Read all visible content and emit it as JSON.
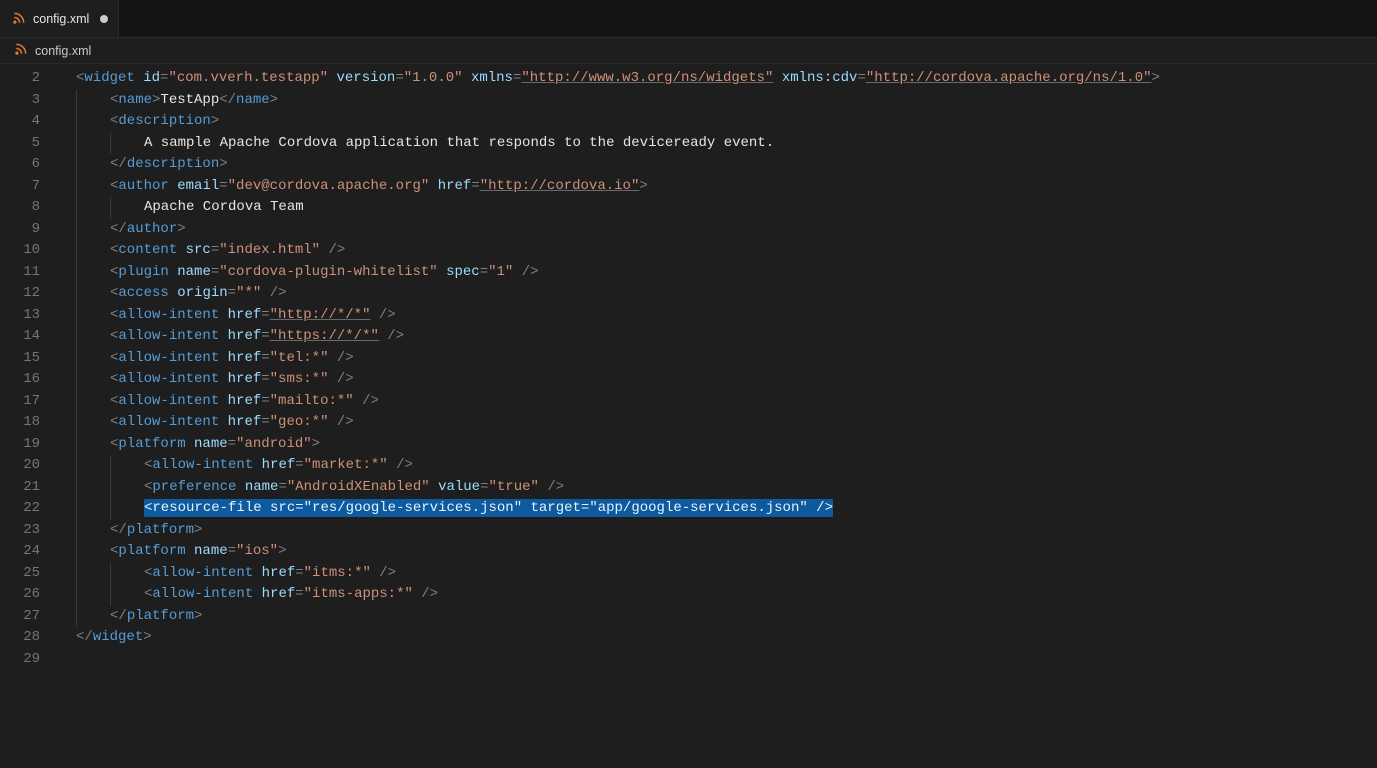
{
  "tab": {
    "filename": "config.xml",
    "dirty": true
  },
  "breadcrumb": {
    "filename": "config.xml"
  },
  "gutter": {
    "start": 2,
    "end": 29
  },
  "code": {
    "lines": [
      {
        "n": 2,
        "indent": 0,
        "sel": false,
        "tokens": [
          {
            "t": "punc",
            "s": "<"
          },
          {
            "t": "tag",
            "s": "widget"
          },
          {
            "t": "text",
            "s": " "
          },
          {
            "t": "attr",
            "s": "id"
          },
          {
            "t": "punc",
            "s": "="
          },
          {
            "t": "str",
            "s": "\"com.vverh.testapp\""
          },
          {
            "t": "text",
            "s": " "
          },
          {
            "t": "attr",
            "s": "version"
          },
          {
            "t": "punc",
            "s": "="
          },
          {
            "t": "str",
            "s": "\"1.0.0\""
          },
          {
            "t": "text",
            "s": " "
          },
          {
            "t": "attr",
            "s": "xmlns"
          },
          {
            "t": "punc",
            "s": "="
          },
          {
            "t": "strl",
            "s": "\"http://www.w3.org/ns/widgets\""
          },
          {
            "t": "text",
            "s": " "
          },
          {
            "t": "attr",
            "s": "xmlns:cdv"
          },
          {
            "t": "punc",
            "s": "="
          },
          {
            "t": "strl",
            "s": "\"http://cordova.apache.org/ns/1.0\""
          },
          {
            "t": "punc",
            "s": ">"
          }
        ]
      },
      {
        "n": 3,
        "indent": 1,
        "sel": false,
        "tokens": [
          {
            "t": "punc",
            "s": "<"
          },
          {
            "t": "tag",
            "s": "name"
          },
          {
            "t": "punc",
            "s": ">"
          },
          {
            "t": "text",
            "s": "TestApp"
          },
          {
            "t": "punc",
            "s": "</"
          },
          {
            "t": "tag",
            "s": "name"
          },
          {
            "t": "punc",
            "s": ">"
          }
        ]
      },
      {
        "n": 4,
        "indent": 1,
        "sel": false,
        "tokens": [
          {
            "t": "punc",
            "s": "<"
          },
          {
            "t": "tag",
            "s": "description"
          },
          {
            "t": "punc",
            "s": ">"
          }
        ]
      },
      {
        "n": 5,
        "indent": 2,
        "sel": false,
        "tokens": [
          {
            "t": "text",
            "s": "A sample Apache Cordova application that responds to the deviceready event."
          }
        ]
      },
      {
        "n": 6,
        "indent": 1,
        "sel": false,
        "tokens": [
          {
            "t": "punc",
            "s": "</"
          },
          {
            "t": "tag",
            "s": "description"
          },
          {
            "t": "punc",
            "s": ">"
          }
        ]
      },
      {
        "n": 7,
        "indent": 1,
        "sel": false,
        "tokens": [
          {
            "t": "punc",
            "s": "<"
          },
          {
            "t": "tag",
            "s": "author"
          },
          {
            "t": "text",
            "s": " "
          },
          {
            "t": "attr",
            "s": "email"
          },
          {
            "t": "punc",
            "s": "="
          },
          {
            "t": "str",
            "s": "\"dev@cordova.apache.org\""
          },
          {
            "t": "text",
            "s": " "
          },
          {
            "t": "attr",
            "s": "href"
          },
          {
            "t": "punc",
            "s": "="
          },
          {
            "t": "strl",
            "s": "\"http://cordova.io\""
          },
          {
            "t": "punc",
            "s": ">"
          }
        ]
      },
      {
        "n": 8,
        "indent": 2,
        "sel": false,
        "tokens": [
          {
            "t": "text",
            "s": "Apache Cordova Team"
          }
        ]
      },
      {
        "n": 9,
        "indent": 1,
        "sel": false,
        "tokens": [
          {
            "t": "punc",
            "s": "</"
          },
          {
            "t": "tag",
            "s": "author"
          },
          {
            "t": "punc",
            "s": ">"
          }
        ]
      },
      {
        "n": 10,
        "indent": 1,
        "sel": false,
        "tokens": [
          {
            "t": "punc",
            "s": "<"
          },
          {
            "t": "tag",
            "s": "content"
          },
          {
            "t": "text",
            "s": " "
          },
          {
            "t": "attr",
            "s": "src"
          },
          {
            "t": "punc",
            "s": "="
          },
          {
            "t": "str",
            "s": "\"index.html\""
          },
          {
            "t": "text",
            "s": " "
          },
          {
            "t": "punc",
            "s": "/>"
          }
        ]
      },
      {
        "n": 11,
        "indent": 1,
        "sel": false,
        "tokens": [
          {
            "t": "punc",
            "s": "<"
          },
          {
            "t": "tag",
            "s": "plugin"
          },
          {
            "t": "text",
            "s": " "
          },
          {
            "t": "attr",
            "s": "name"
          },
          {
            "t": "punc",
            "s": "="
          },
          {
            "t": "str",
            "s": "\"cordova-plugin-whitelist\""
          },
          {
            "t": "text",
            "s": " "
          },
          {
            "t": "attr",
            "s": "spec"
          },
          {
            "t": "punc",
            "s": "="
          },
          {
            "t": "str",
            "s": "\"1\""
          },
          {
            "t": "text",
            "s": " "
          },
          {
            "t": "punc",
            "s": "/>"
          }
        ]
      },
      {
        "n": 12,
        "indent": 1,
        "sel": false,
        "tokens": [
          {
            "t": "punc",
            "s": "<"
          },
          {
            "t": "tag",
            "s": "access"
          },
          {
            "t": "text",
            "s": " "
          },
          {
            "t": "attr",
            "s": "origin"
          },
          {
            "t": "punc",
            "s": "="
          },
          {
            "t": "str",
            "s": "\"*\""
          },
          {
            "t": "text",
            "s": " "
          },
          {
            "t": "punc",
            "s": "/>"
          }
        ]
      },
      {
        "n": 13,
        "indent": 1,
        "sel": false,
        "tokens": [
          {
            "t": "punc",
            "s": "<"
          },
          {
            "t": "tag",
            "s": "allow-intent"
          },
          {
            "t": "text",
            "s": " "
          },
          {
            "t": "attr",
            "s": "href"
          },
          {
            "t": "punc",
            "s": "="
          },
          {
            "t": "strl",
            "s": "\"http://*/*\""
          },
          {
            "t": "text",
            "s": " "
          },
          {
            "t": "punc",
            "s": "/>"
          }
        ]
      },
      {
        "n": 14,
        "indent": 1,
        "sel": false,
        "tokens": [
          {
            "t": "punc",
            "s": "<"
          },
          {
            "t": "tag",
            "s": "allow-intent"
          },
          {
            "t": "text",
            "s": " "
          },
          {
            "t": "attr",
            "s": "href"
          },
          {
            "t": "punc",
            "s": "="
          },
          {
            "t": "strl",
            "s": "\"https://*/*\""
          },
          {
            "t": "text",
            "s": " "
          },
          {
            "t": "punc",
            "s": "/>"
          }
        ]
      },
      {
        "n": 15,
        "indent": 1,
        "sel": false,
        "tokens": [
          {
            "t": "punc",
            "s": "<"
          },
          {
            "t": "tag",
            "s": "allow-intent"
          },
          {
            "t": "text",
            "s": " "
          },
          {
            "t": "attr",
            "s": "href"
          },
          {
            "t": "punc",
            "s": "="
          },
          {
            "t": "str",
            "s": "\"tel:*\""
          },
          {
            "t": "text",
            "s": " "
          },
          {
            "t": "punc",
            "s": "/>"
          }
        ]
      },
      {
        "n": 16,
        "indent": 1,
        "sel": false,
        "tokens": [
          {
            "t": "punc",
            "s": "<"
          },
          {
            "t": "tag",
            "s": "allow-intent"
          },
          {
            "t": "text",
            "s": " "
          },
          {
            "t": "attr",
            "s": "href"
          },
          {
            "t": "punc",
            "s": "="
          },
          {
            "t": "str",
            "s": "\"sms:*\""
          },
          {
            "t": "text",
            "s": " "
          },
          {
            "t": "punc",
            "s": "/>"
          }
        ]
      },
      {
        "n": 17,
        "indent": 1,
        "sel": false,
        "tokens": [
          {
            "t": "punc",
            "s": "<"
          },
          {
            "t": "tag",
            "s": "allow-intent"
          },
          {
            "t": "text",
            "s": " "
          },
          {
            "t": "attr",
            "s": "href"
          },
          {
            "t": "punc",
            "s": "="
          },
          {
            "t": "str",
            "s": "\"mailto:*\""
          },
          {
            "t": "text",
            "s": " "
          },
          {
            "t": "punc",
            "s": "/>"
          }
        ]
      },
      {
        "n": 18,
        "indent": 1,
        "sel": false,
        "tokens": [
          {
            "t": "punc",
            "s": "<"
          },
          {
            "t": "tag",
            "s": "allow-intent"
          },
          {
            "t": "text",
            "s": " "
          },
          {
            "t": "attr",
            "s": "href"
          },
          {
            "t": "punc",
            "s": "="
          },
          {
            "t": "str",
            "s": "\"geo:*\""
          },
          {
            "t": "text",
            "s": " "
          },
          {
            "t": "punc",
            "s": "/>"
          }
        ]
      },
      {
        "n": 19,
        "indent": 1,
        "sel": false,
        "tokens": [
          {
            "t": "punc",
            "s": "<"
          },
          {
            "t": "tag",
            "s": "platform"
          },
          {
            "t": "text",
            "s": " "
          },
          {
            "t": "attr",
            "s": "name"
          },
          {
            "t": "punc",
            "s": "="
          },
          {
            "t": "str",
            "s": "\"android\""
          },
          {
            "t": "punc",
            "s": ">"
          }
        ]
      },
      {
        "n": 20,
        "indent": 2,
        "sel": false,
        "tokens": [
          {
            "t": "punc",
            "s": "<"
          },
          {
            "t": "tag",
            "s": "allow-intent"
          },
          {
            "t": "text",
            "s": " "
          },
          {
            "t": "attr",
            "s": "href"
          },
          {
            "t": "punc",
            "s": "="
          },
          {
            "t": "str",
            "s": "\"market:*\""
          },
          {
            "t": "text",
            "s": " "
          },
          {
            "t": "punc",
            "s": "/>"
          }
        ]
      },
      {
        "n": 21,
        "indent": 2,
        "sel": false,
        "tokens": [
          {
            "t": "punc",
            "s": "<"
          },
          {
            "t": "tag",
            "s": "preference"
          },
          {
            "t": "text",
            "s": " "
          },
          {
            "t": "attr",
            "s": "name"
          },
          {
            "t": "punc",
            "s": "="
          },
          {
            "t": "str",
            "s": "\"AndroidXEnabled\""
          },
          {
            "t": "text",
            "s": " "
          },
          {
            "t": "attr",
            "s": "value"
          },
          {
            "t": "punc",
            "s": "="
          },
          {
            "t": "str",
            "s": "\"true\""
          },
          {
            "t": "text",
            "s": " "
          },
          {
            "t": "punc",
            "s": "/>"
          }
        ]
      },
      {
        "n": 22,
        "indent": 2,
        "sel": true,
        "tokens": [
          {
            "t": "punc",
            "s": "<"
          },
          {
            "t": "tag",
            "s": "resource-file"
          },
          {
            "t": "text",
            "s": " "
          },
          {
            "t": "attr",
            "s": "src"
          },
          {
            "t": "punc",
            "s": "="
          },
          {
            "t": "str",
            "s": "\"res/google-services.json\""
          },
          {
            "t": "text",
            "s": " "
          },
          {
            "t": "attr",
            "s": "target"
          },
          {
            "t": "punc",
            "s": "="
          },
          {
            "t": "str",
            "s": "\"app/google-services.json\""
          },
          {
            "t": "text",
            "s": " "
          },
          {
            "t": "punc",
            "s": "/>"
          }
        ]
      },
      {
        "n": 23,
        "indent": 1,
        "sel": false,
        "tokens": [
          {
            "t": "punc",
            "s": "</"
          },
          {
            "t": "tag",
            "s": "platform"
          },
          {
            "t": "punc",
            "s": ">"
          }
        ]
      },
      {
        "n": 24,
        "indent": 1,
        "sel": false,
        "tokens": [
          {
            "t": "punc",
            "s": "<"
          },
          {
            "t": "tag",
            "s": "platform"
          },
          {
            "t": "text",
            "s": " "
          },
          {
            "t": "attr",
            "s": "name"
          },
          {
            "t": "punc",
            "s": "="
          },
          {
            "t": "str",
            "s": "\"ios\""
          },
          {
            "t": "punc",
            "s": ">"
          }
        ]
      },
      {
        "n": 25,
        "indent": 2,
        "sel": false,
        "tokens": [
          {
            "t": "punc",
            "s": "<"
          },
          {
            "t": "tag",
            "s": "allow-intent"
          },
          {
            "t": "text",
            "s": " "
          },
          {
            "t": "attr",
            "s": "href"
          },
          {
            "t": "punc",
            "s": "="
          },
          {
            "t": "str",
            "s": "\"itms:*\""
          },
          {
            "t": "text",
            "s": " "
          },
          {
            "t": "punc",
            "s": "/>"
          }
        ]
      },
      {
        "n": 26,
        "indent": 2,
        "sel": false,
        "tokens": [
          {
            "t": "punc",
            "s": "<"
          },
          {
            "t": "tag",
            "s": "allow-intent"
          },
          {
            "t": "text",
            "s": " "
          },
          {
            "t": "attr",
            "s": "href"
          },
          {
            "t": "punc",
            "s": "="
          },
          {
            "t": "str",
            "s": "\"itms-apps:*\""
          },
          {
            "t": "text",
            "s": " "
          },
          {
            "t": "punc",
            "s": "/>"
          }
        ]
      },
      {
        "n": 27,
        "indent": 1,
        "sel": false,
        "tokens": [
          {
            "t": "punc",
            "s": "</"
          },
          {
            "t": "tag",
            "s": "platform"
          },
          {
            "t": "punc",
            "s": ">"
          }
        ]
      },
      {
        "n": 28,
        "indent": 0,
        "sel": false,
        "tokens": [
          {
            "t": "punc",
            "s": "</"
          },
          {
            "t": "tag",
            "s": "widget"
          },
          {
            "t": "punc",
            "s": ">"
          }
        ]
      },
      {
        "n": 29,
        "indent": 0,
        "sel": false,
        "tokens": []
      }
    ]
  }
}
